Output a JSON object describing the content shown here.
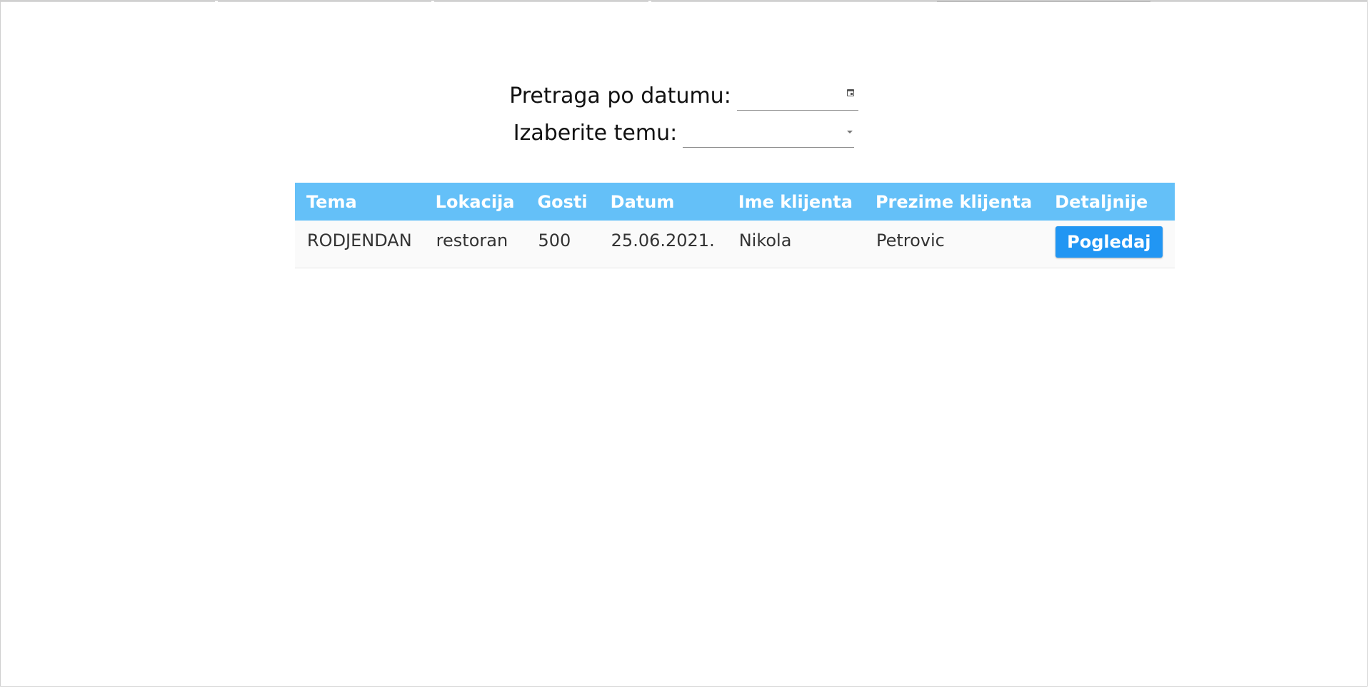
{
  "filters": {
    "date_label": "Pretraga po datumu:",
    "date_value": "",
    "theme_label": "Izaberite temu:",
    "theme_value": ""
  },
  "table": {
    "columns": [
      "Tema",
      "Lokacija",
      "Gosti",
      "Datum",
      "Ime klijenta",
      "Prezime klijenta",
      "Detaljnije"
    ],
    "rows": [
      {
        "tema": "RODJENDAN",
        "lokacija": "restoran",
        "gosti": "500",
        "datum": "25.06.2021.",
        "ime": "Nikola",
        "prezime": "Petrovic",
        "button_label": "Pogledaj"
      }
    ]
  },
  "colors": {
    "header_bg": "#64c0f8",
    "button_bg": "#2196f3"
  },
  "icons": {
    "date_picker": "calendar-icon",
    "select": "caret-down-icon"
  }
}
